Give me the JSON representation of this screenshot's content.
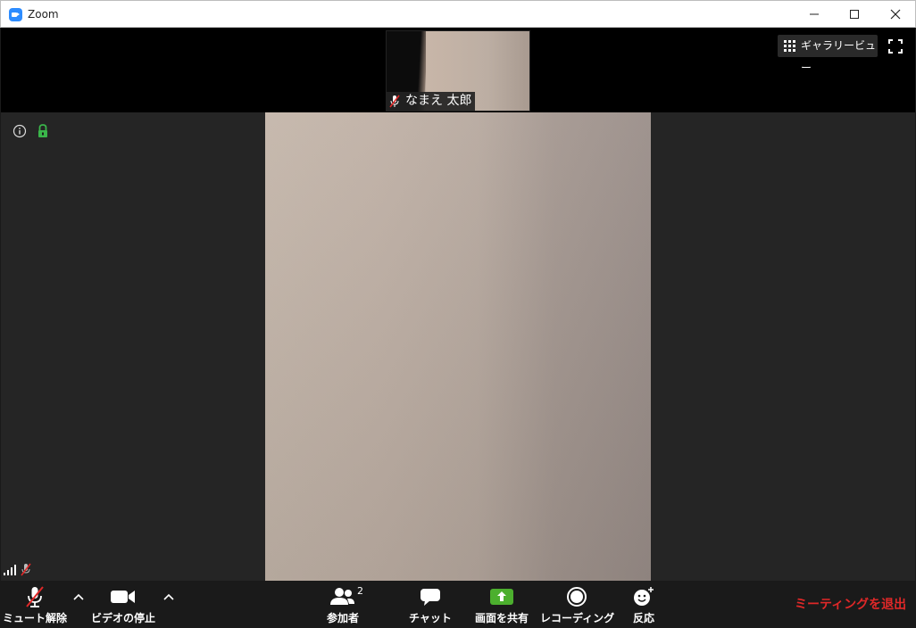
{
  "window": {
    "title": "Zoom"
  },
  "top": {
    "participant_name": "なまえ 太郎",
    "gallery_view_label": "ギャラリービュー"
  },
  "toolbar": {
    "unmute_label": "ミュート解除",
    "stop_video_label": "ビデオの停止",
    "participants_label": "参加者",
    "participants_count": "2",
    "chat_label": "チャット",
    "share_label": "画面を共有",
    "record_label": "レコーディング",
    "reactions_label": "反応",
    "leave_label": "ミーティングを退出"
  },
  "colors": {
    "accent": "#2d8cff",
    "share_green": "#4caf2e",
    "leave_red": "#e02828",
    "lock_green": "#3ab54a"
  },
  "icons": [
    "zoom-logo-icon",
    "minimize-icon",
    "maximize-icon",
    "close-icon",
    "grid-icon",
    "fullscreen-icon",
    "info-icon",
    "lock-icon",
    "mic-off-icon",
    "video-icon",
    "participants-icon",
    "chat-icon",
    "share-screen-icon",
    "record-icon",
    "reaction-icon",
    "chevron-up-icon",
    "signal-icon"
  ]
}
